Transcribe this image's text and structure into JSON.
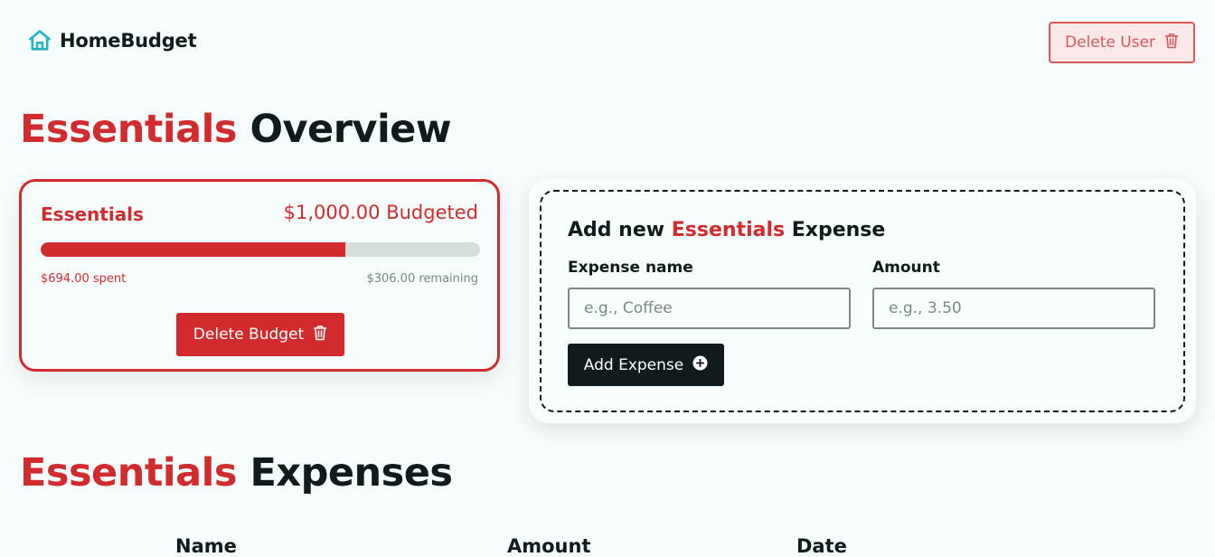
{
  "header": {
    "brand_name": "HomeBudget",
    "brand_icon": "house-icon",
    "delete_user_label": "Delete User",
    "delete_user_icon": "trash-icon"
  },
  "overview": {
    "title_accent": "Essentials",
    "title_rest": " Overview"
  },
  "budget": {
    "name": "Essentials",
    "budgeted": "$1,000.00 Budgeted",
    "spent": "$694.00 spent",
    "remaining": "$306.00 remaining",
    "progress": 0.694,
    "delete_label": "Delete Budget",
    "delete_icon": "trash-icon"
  },
  "add_expense": {
    "title_prefix": "Add new ",
    "title_accent": "Essentials",
    "title_suffix": " Expense",
    "name_label": "Expense name",
    "name_placeholder": "e.g., Coffee",
    "amount_label": "Amount",
    "amount_placeholder": "e.g., 3.50",
    "submit_label": "Add Expense",
    "submit_icon": "plus-circle-icon"
  },
  "expenses": {
    "title_accent": "Essentials",
    "title_rest": " Expenses",
    "columns": [
      "Name",
      "Amount",
      "Date"
    ]
  },
  "colors": {
    "accent": "#d22b2e",
    "dark": "#111a1c",
    "brand_icon": "#1fb5c4",
    "background": "#f6fcfc"
  }
}
